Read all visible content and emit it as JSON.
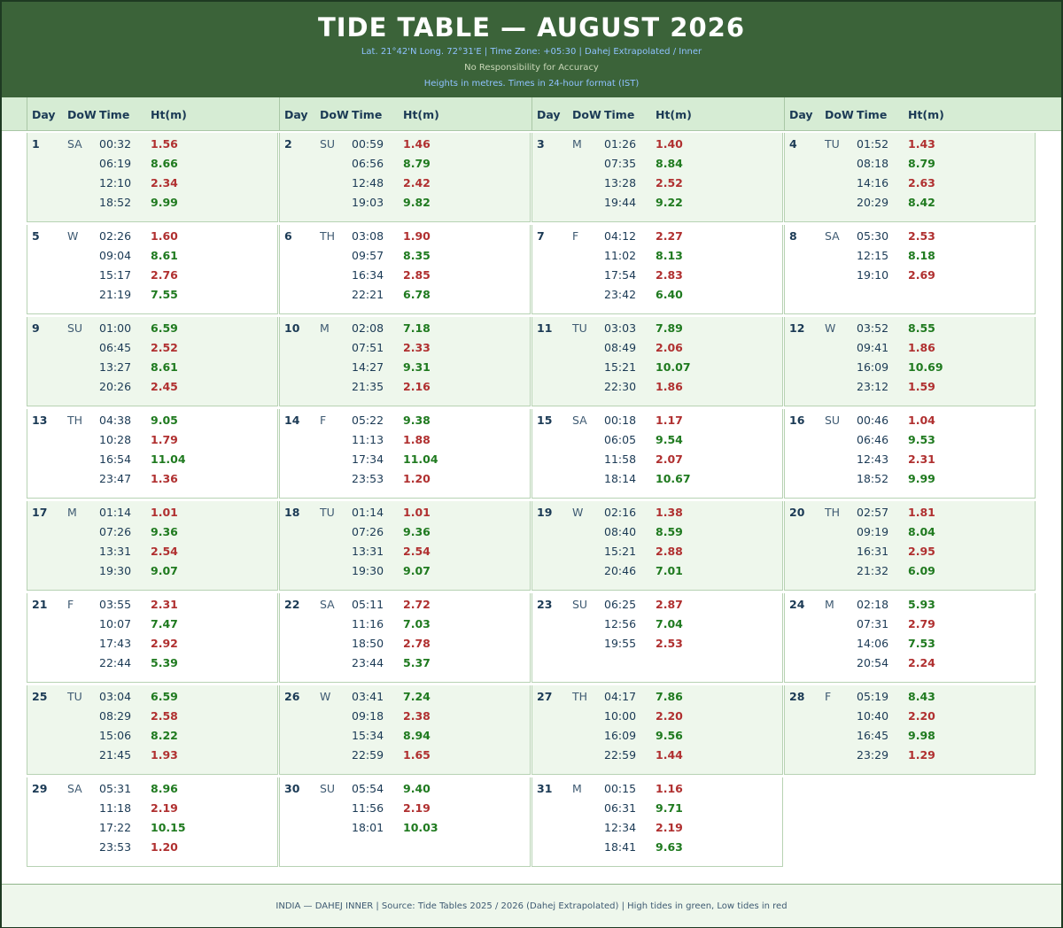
{
  "header": {
    "title": "TIDE TABLE — AUGUST 2026",
    "subtitle1": "Lat. 21°42'N  Long. 72°31'E   |   Time Zone: +05:30   |   Dahej Extrapolated / Inner",
    "subtitle2": "No Responsibility for Accuracy",
    "subtitle3": "Heights in metres.  Times in 24-hour format (IST)"
  },
  "columns": {
    "day": "Day",
    "dow": "DoW",
    "time": "Time",
    "ht": "Ht(m)"
  },
  "colors": {
    "high": "#1f7a1f",
    "low": "#b03030",
    "header_bg": "#3b6339",
    "shade": "#eef7ec"
  },
  "days": [
    {
      "day": "1",
      "dow": "SA",
      "tides": [
        [
          "00:32",
          "1.56",
          "low"
        ],
        [
          "06:19",
          "8.66",
          "high"
        ],
        [
          "12:10",
          "2.34",
          "low"
        ],
        [
          "18:52",
          "9.99",
          "high"
        ]
      ]
    },
    {
      "day": "2",
      "dow": "SU",
      "tides": [
        [
          "00:59",
          "1.46",
          "low"
        ],
        [
          "06:56",
          "8.79",
          "high"
        ],
        [
          "12:48",
          "2.42",
          "low"
        ],
        [
          "19:03",
          "9.82",
          "high"
        ]
      ]
    },
    {
      "day": "3",
      "dow": "M",
      "tides": [
        [
          "01:26",
          "1.40",
          "low"
        ],
        [
          "07:35",
          "8.84",
          "high"
        ],
        [
          "13:28",
          "2.52",
          "low"
        ],
        [
          "19:44",
          "9.22",
          "high"
        ]
      ]
    },
    {
      "day": "4",
      "dow": "TU",
      "tides": [
        [
          "01:52",
          "1.43",
          "low"
        ],
        [
          "08:18",
          "8.79",
          "high"
        ],
        [
          "14:16",
          "2.63",
          "low"
        ],
        [
          "20:29",
          "8.42",
          "high"
        ]
      ]
    },
    {
      "day": "5",
      "dow": "W",
      "tides": [
        [
          "02:26",
          "1.60",
          "low"
        ],
        [
          "09:04",
          "8.61",
          "high"
        ],
        [
          "15:17",
          "2.76",
          "low"
        ],
        [
          "21:19",
          "7.55",
          "high"
        ]
      ]
    },
    {
      "day": "6",
      "dow": "TH",
      "tides": [
        [
          "03:08",
          "1.90",
          "low"
        ],
        [
          "09:57",
          "8.35",
          "high"
        ],
        [
          "16:34",
          "2.85",
          "low"
        ],
        [
          "22:21",
          "6.78",
          "high"
        ]
      ]
    },
    {
      "day": "7",
      "dow": "F",
      "tides": [
        [
          "04:12",
          "2.27",
          "low"
        ],
        [
          "11:02",
          "8.13",
          "high"
        ],
        [
          "17:54",
          "2.83",
          "low"
        ],
        [
          "23:42",
          "6.40",
          "high"
        ]
      ]
    },
    {
      "day": "8",
      "dow": "SA",
      "tides": [
        [
          "05:30",
          "2.53",
          "low"
        ],
        [
          "12:15",
          "8.18",
          "high"
        ],
        [
          "19:10",
          "2.69",
          "low"
        ]
      ]
    },
    {
      "day": "9",
      "dow": "SU",
      "tides": [
        [
          "01:00",
          "6.59",
          "high"
        ],
        [
          "06:45",
          "2.52",
          "low"
        ],
        [
          "13:27",
          "8.61",
          "high"
        ],
        [
          "20:26",
          "2.45",
          "low"
        ]
      ]
    },
    {
      "day": "10",
      "dow": "M",
      "tides": [
        [
          "02:08",
          "7.18",
          "high"
        ],
        [
          "07:51",
          "2.33",
          "low"
        ],
        [
          "14:27",
          "9.31",
          "high"
        ],
        [
          "21:35",
          "2.16",
          "low"
        ]
      ]
    },
    {
      "day": "11",
      "dow": "TU",
      "tides": [
        [
          "03:03",
          "7.89",
          "high"
        ],
        [
          "08:49",
          "2.06",
          "low"
        ],
        [
          "15:21",
          "10.07",
          "high"
        ],
        [
          "22:30",
          "1.86",
          "low"
        ]
      ]
    },
    {
      "day": "12",
      "dow": "W",
      "tides": [
        [
          "03:52",
          "8.55",
          "high"
        ],
        [
          "09:41",
          "1.86",
          "low"
        ],
        [
          "16:09",
          "10.69",
          "high"
        ],
        [
          "23:12",
          "1.59",
          "low"
        ]
      ]
    },
    {
      "day": "13",
      "dow": "TH",
      "tides": [
        [
          "04:38",
          "9.05",
          "high"
        ],
        [
          "10:28",
          "1.79",
          "low"
        ],
        [
          "16:54",
          "11.04",
          "high"
        ],
        [
          "23:47",
          "1.36",
          "low"
        ]
      ]
    },
    {
      "day": "14",
      "dow": "F",
      "tides": [
        [
          "05:22",
          "9.38",
          "high"
        ],
        [
          "11:13",
          "1.88",
          "low"
        ],
        [
          "17:34",
          "11.04",
          "high"
        ],
        [
          "23:53",
          "1.20",
          "low"
        ]
      ]
    },
    {
      "day": "15",
      "dow": "SA",
      "tides": [
        [
          "00:18",
          "1.17",
          "low"
        ],
        [
          "06:05",
          "9.54",
          "high"
        ],
        [
          "11:58",
          "2.07",
          "low"
        ],
        [
          "18:14",
          "10.67",
          "high"
        ]
      ]
    },
    {
      "day": "16",
      "dow": "SU",
      "tides": [
        [
          "00:46",
          "1.04",
          "low"
        ],
        [
          "06:46",
          "9.53",
          "high"
        ],
        [
          "12:43",
          "2.31",
          "low"
        ],
        [
          "18:52",
          "9.99",
          "high"
        ]
      ]
    },
    {
      "day": "17",
      "dow": "M",
      "tides": [
        [
          "01:14",
          "1.01",
          "low"
        ],
        [
          "07:26",
          "9.36",
          "high"
        ],
        [
          "13:31",
          "2.54",
          "low"
        ],
        [
          "19:30",
          "9.07",
          "high"
        ]
      ]
    },
    {
      "day": "18",
      "dow": "TU",
      "tides": [
        [
          "01:14",
          "1.01",
          "low"
        ],
        [
          "07:26",
          "9.36",
          "high"
        ],
        [
          "13:31",
          "2.54",
          "low"
        ],
        [
          "19:30",
          "9.07",
          "high"
        ]
      ]
    },
    {
      "day": "19",
      "dow": "W",
      "tides": [
        [
          "02:16",
          "1.38",
          "low"
        ],
        [
          "08:40",
          "8.59",
          "high"
        ],
        [
          "15:21",
          "2.88",
          "low"
        ],
        [
          "20:46",
          "7.01",
          "high"
        ]
      ]
    },
    {
      "day": "20",
      "dow": "TH",
      "tides": [
        [
          "02:57",
          "1.81",
          "low"
        ],
        [
          "09:19",
          "8.04",
          "high"
        ],
        [
          "16:31",
          "2.95",
          "low"
        ],
        [
          "21:32",
          "6.09",
          "high"
        ]
      ]
    },
    {
      "day": "21",
      "dow": "F",
      "tides": [
        [
          "03:55",
          "2.31",
          "low"
        ],
        [
          "10:07",
          "7.47",
          "high"
        ],
        [
          "17:43",
          "2.92",
          "low"
        ],
        [
          "22:44",
          "5.39",
          "high"
        ]
      ]
    },
    {
      "day": "22",
      "dow": "SA",
      "tides": [
        [
          "05:11",
          "2.72",
          "low"
        ],
        [
          "11:16",
          "7.03",
          "high"
        ],
        [
          "18:50",
          "2.78",
          "low"
        ],
        [
          "23:44",
          "5.37",
          "high"
        ]
      ]
    },
    {
      "day": "23",
      "dow": "SU",
      "tides": [
        [
          "06:25",
          "2.87",
          "low"
        ],
        [
          "12:56",
          "7.04",
          "high"
        ],
        [
          "19:55",
          "2.53",
          "low"
        ]
      ]
    },
    {
      "day": "24",
      "dow": "M",
      "tides": [
        [
          "02:18",
          "5.93",
          "high"
        ],
        [
          "07:31",
          "2.79",
          "low"
        ],
        [
          "14:06",
          "7.53",
          "high"
        ],
        [
          "20:54",
          "2.24",
          "low"
        ]
      ]
    },
    {
      "day": "25",
      "dow": "TU",
      "tides": [
        [
          "03:04",
          "6.59",
          "high"
        ],
        [
          "08:29",
          "2.58",
          "low"
        ],
        [
          "15:06",
          "8.22",
          "high"
        ],
        [
          "21:45",
          "1.93",
          "low"
        ]
      ]
    },
    {
      "day": "26",
      "dow": "W",
      "tides": [
        [
          "03:41",
          "7.24",
          "high"
        ],
        [
          "09:18",
          "2.38",
          "low"
        ],
        [
          "15:34",
          "8.94",
          "high"
        ],
        [
          "22:59",
          "1.65",
          "low"
        ]
      ]
    },
    {
      "day": "27",
      "dow": "TH",
      "tides": [
        [
          "04:17",
          "7.86",
          "high"
        ],
        [
          "10:00",
          "2.20",
          "low"
        ],
        [
          "16:09",
          "9.56",
          "high"
        ],
        [
          "22:59",
          "1.44",
          "low"
        ]
      ]
    },
    {
      "day": "28",
      "dow": "F",
      "tides": [
        [
          "05:19",
          "8.43",
          "high"
        ],
        [
          "10:40",
          "2.20",
          "low"
        ],
        [
          "16:45",
          "9.98",
          "high"
        ],
        [
          "23:29",
          "1.29",
          "low"
        ]
      ]
    },
    {
      "day": "29",
      "dow": "SA",
      "tides": [
        [
          "05:31",
          "8.96",
          "high"
        ],
        [
          "11:18",
          "2.19",
          "low"
        ],
        [
          "17:22",
          "10.15",
          "high"
        ],
        [
          "23:53",
          "1.20",
          "low"
        ]
      ]
    },
    {
      "day": "30",
      "dow": "SU",
      "tides": [
        [
          "05:54",
          "9.40",
          "high"
        ],
        [
          "11:56",
          "2.19",
          "low"
        ],
        [
          "18:01",
          "10.03",
          "high"
        ]
      ]
    },
    {
      "day": "31",
      "dow": "M",
      "tides": [
        [
          "00:15",
          "1.16",
          "low"
        ],
        [
          "06:31",
          "9.71",
          "high"
        ],
        [
          "12:34",
          "2.19",
          "low"
        ],
        [
          "18:41",
          "9.63",
          "high"
        ]
      ]
    }
  ],
  "footer": "INDIA — DAHEJ INNER   |   Source: Tide Tables 2025 / 2026 (Dahej Extrapolated)   |   High tides in green, Low tides in red"
}
